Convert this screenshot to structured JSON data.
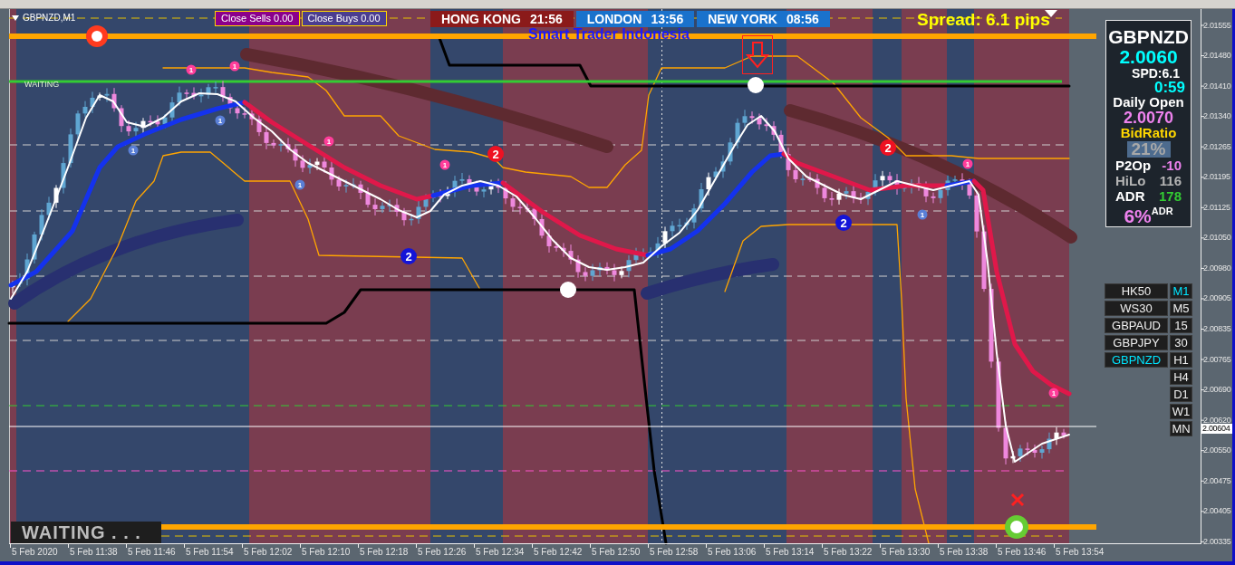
{
  "chart": {
    "symbol_title": "GBPNZD,M1",
    "close_buttons": [
      {
        "label": "Close Sells 0.00",
        "kind": "sells"
      },
      {
        "label": "Close Buys 0.00",
        "kind": "buys"
      }
    ],
    "sessions": [
      {
        "city": "HONG KONG",
        "time": "21:56",
        "color": "#8b1a1a"
      },
      {
        "city": "LONDON",
        "time": "13:56",
        "color": "#1a72cc"
      },
      {
        "city": "NEW YORK",
        "time": "08:56",
        "color": "#1a72cc"
      }
    ],
    "brand": "Smart Trader Indonesia",
    "spread": "Spread: 6.1 pips",
    "signal_label": "WAITING",
    "status_banner": "WAITING . . .",
    "markers": [
      {
        "label": "1",
        "kind": "small",
        "color": "#ff3d9a"
      },
      {
        "label": "1",
        "kind": "small",
        "color": "#ff3d9a"
      },
      {
        "label": "1",
        "kind": "small",
        "color": "#5a7fd6"
      },
      {
        "label": "1",
        "kind": "small",
        "color": "#5a7fd6"
      },
      {
        "label": "1",
        "kind": "small",
        "color": "#5a7fd6"
      },
      {
        "label": "1",
        "kind": "small",
        "color": "#ff3d9a"
      },
      {
        "label": "2",
        "kind": "large",
        "color": "#1414d8"
      },
      {
        "label": "1",
        "kind": "small",
        "color": "#ff3d9a"
      },
      {
        "label": "2",
        "kind": "large",
        "color": "#ee1122"
      },
      {
        "label": "2",
        "kind": "large",
        "color": "#1414d8"
      },
      {
        "label": "2",
        "kind": "large",
        "color": "#ee1122"
      },
      {
        "label": "1",
        "kind": "small",
        "color": "#5a7fd6"
      },
      {
        "label": "1",
        "kind": "small",
        "color": "#ff3d9a"
      },
      {
        "label": "1",
        "kind": "small",
        "color": "#ff3d9a"
      }
    ]
  },
  "info_panel": {
    "symbol": "GBPNZD",
    "bid": "2.0060",
    "spread": "SPD:6.1",
    "countdown": "0:59",
    "daily_open_label": "Daily Open",
    "daily_open": "2.0070",
    "bid_ratio_label": "BidRatio",
    "bid_ratio": "21%",
    "stats": [
      {
        "label": "P2Op",
        "value": "-10",
        "dimmed": false,
        "color": "#ee82ee"
      },
      {
        "label": "HiLo",
        "value": "116",
        "dimmed": true,
        "color": "#b4b4b4"
      },
      {
        "label": "ADR",
        "value": "178",
        "dimmed": false,
        "color": "#33cc33"
      }
    ],
    "adr_usage": "6%$^{ADR}$"
  },
  "symbol_buttons": [
    {
      "label": "HK50",
      "selected": false
    },
    {
      "label": "WS30",
      "selected": false
    },
    {
      "label": "GBPAUD",
      "selected": false
    },
    {
      "label": "GBPJPY",
      "selected": false
    },
    {
      "label": "GBPNZD",
      "selected": true
    }
  ],
  "timeframe_buttons": [
    {
      "label": "M1",
      "selected": true
    },
    {
      "label": "M5",
      "selected": false
    },
    {
      "label": "15",
      "selected": false
    },
    {
      "label": "30",
      "selected": false
    },
    {
      "label": "H1",
      "selected": false
    },
    {
      "label": "H4",
      "selected": false
    },
    {
      "label": "D1",
      "selected": false
    },
    {
      "label": "W1",
      "selected": false
    },
    {
      "label": "MN",
      "selected": false
    }
  ],
  "price_axis": {
    "ticks": [
      "2.01555",
      "2.01480",
      "2.01410",
      "2.01340",
      "2.01265",
      "2.01195",
      "2.01125",
      "2.01050",
      "2.00980",
      "2.00905",
      "2.00835",
      "2.00765",
      "2.00690",
      "2.00620",
      "2.00550",
      "2.00475",
      "2.00405",
      "2.00335"
    ],
    "current_price": "2.00604"
  },
  "time_axis": [
    "5 Feb 2020",
    "5 Feb 11:38",
    "5 Feb 11:46",
    "5 Feb 11:54",
    "5 Feb 12:02",
    "5 Feb 12:10",
    "5 Feb 12:18",
    "5 Feb 12:26",
    "5 Feb 12:34",
    "5 Feb 12:42",
    "5 Feb 12:50",
    "5 Feb 12:58",
    "5 Feb 13:06",
    "5 Feb 13:14",
    "5 Feb 13:22",
    "5 Feb 13:30",
    "5 Feb 13:38",
    "5 Feb 13:46",
    "5 Feb 13:54"
  ]
}
